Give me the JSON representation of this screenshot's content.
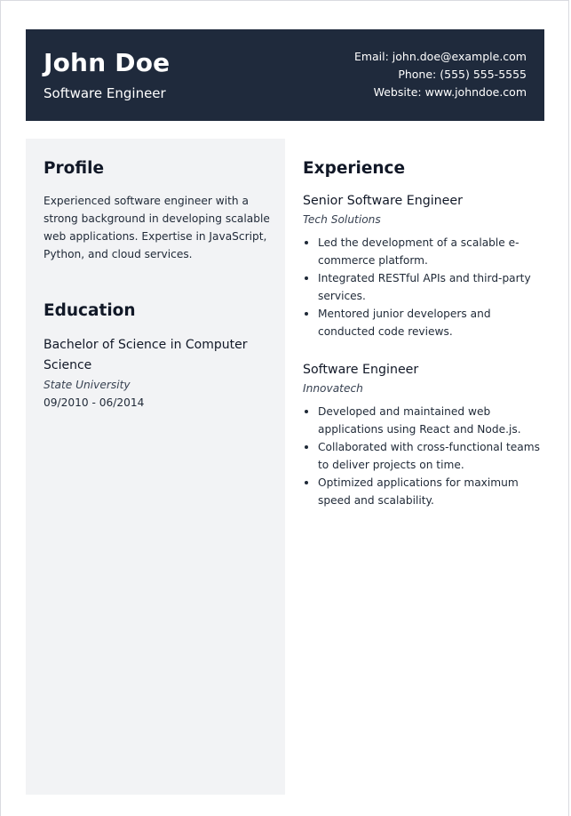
{
  "header": {
    "name": "John Doe",
    "title": "Software Engineer",
    "email": "Email: john.doe@example.com",
    "phone": "Phone: (555) 555-5555",
    "website": "Website: www.johndoe.com"
  },
  "profile": {
    "heading": "Profile",
    "text": "Experienced software engineer with a strong background in developing scalable web applications. Expertise in JavaScript, Python, and cloud services."
  },
  "education": {
    "heading": "Education",
    "degree": "Bachelor of Science in Computer Science",
    "school": "State University",
    "dates": "09/2010 - 06/2014"
  },
  "experience": {
    "heading": "Experience",
    "jobs": [
      {
        "title": "Senior Software Engineer",
        "company": "Tech Solutions",
        "bullets": [
          "Led the development of a scalable e-commerce platform.",
          "Integrated RESTful APIs and third-party services.",
          "Mentored junior developers and conducted code reviews."
        ]
      },
      {
        "title": "Software Engineer",
        "company": "Innovatech",
        "bullets": [
          "Developed and maintained web applications using React and Node.js.",
          "Collaborated with cross-functional teams to deliver projects on time.",
          "Optimized applications for maximum speed and scalability."
        ]
      }
    ]
  },
  "colors": {
    "header_bg": "#1f2a3c",
    "sidebar_bg": "#f2f3f5",
    "text": "#1f2937"
  }
}
